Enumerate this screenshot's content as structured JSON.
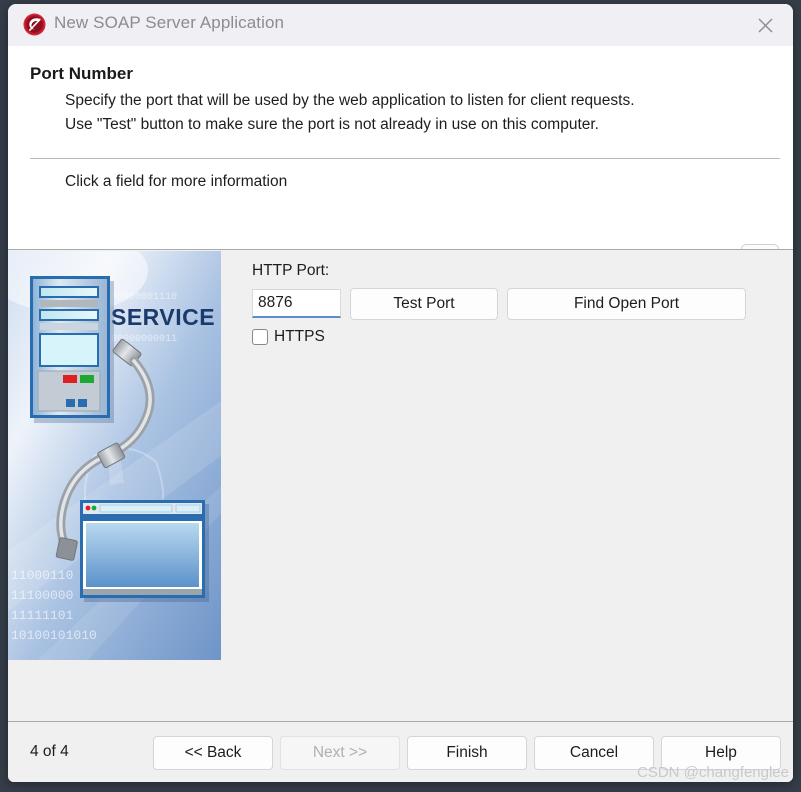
{
  "window": {
    "title": "New SOAP Server Application",
    "app_icon": "soap-server-icon",
    "close_icon": "close-icon"
  },
  "header": {
    "page_title": "Port Number",
    "description_line_1": "Specify the port that will be used by the web application to listen for client requests.",
    "description_line_2": "Use \"Test\" button to make sure the port is not already in use on this computer.",
    "hint": "Click a field for more information",
    "info_icon": "info-icon"
  },
  "illustration": {
    "service_text": "SERVICE",
    "binary_top": "00000001110",
    "binary_top2": "00000000011",
    "binary_rows": [
      "11000110",
      "11100000",
      "11111101",
      "10100101010"
    ]
  },
  "form": {
    "port_label": "HTTP Port:",
    "port_value": "8876",
    "port_placeholder": "",
    "test_port_label": "Test Port",
    "find_open_port_label": "Find Open Port",
    "https_label": "HTTPS",
    "https_checked": false
  },
  "footer": {
    "step_label": "4 of 4",
    "back_label": "<< Back",
    "next_label": "Next >>",
    "next_disabled": true,
    "finish_label": "Finish",
    "cancel_label": "Cancel",
    "help_label": "Help"
  },
  "watermark": {
    "text": "CSDN @changfenglee"
  },
  "colors": {
    "titlebar_bg": "#f0f0f4",
    "panel_bg": "#f0f0f0",
    "desktop_bg": "#353d48",
    "focus_accent": "#5b8fc9",
    "icon_red": "#c0182b",
    "info_blue": "#2d6fb5"
  }
}
